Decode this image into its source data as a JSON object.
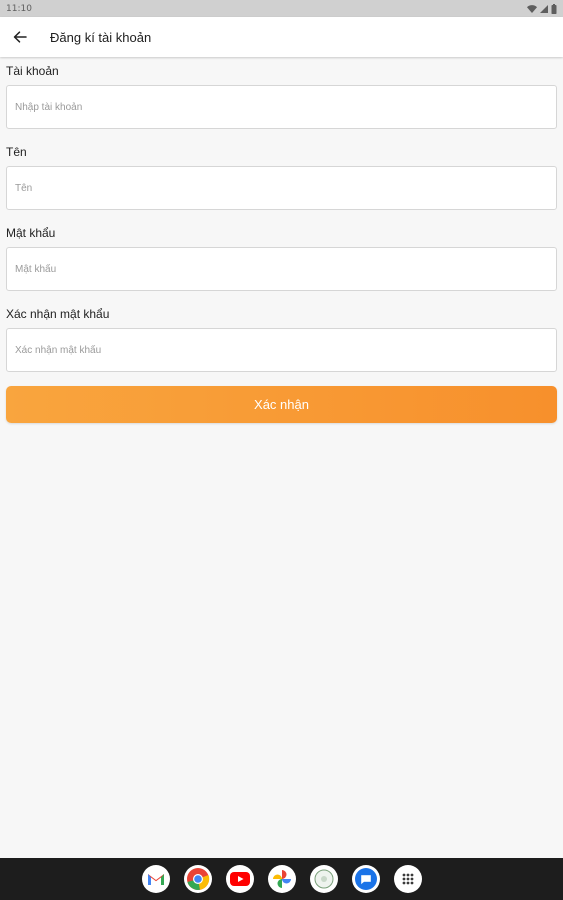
{
  "status_bar": {
    "time": "11:10",
    "icons": [
      "wifi-icon",
      "signal-icon",
      "battery-icon"
    ]
  },
  "app_bar": {
    "back_icon": "arrow-left-icon",
    "title": "Đăng kí tài khoản"
  },
  "form": {
    "fields": [
      {
        "label": "Tài khoản",
        "placeholder": "Nhập tài khoản",
        "value": ""
      },
      {
        "label": "Tên",
        "placeholder": "Tên",
        "value": ""
      },
      {
        "label": "Mật khẩu",
        "placeholder": "Mật khẩu",
        "value": ""
      },
      {
        "label": "Xác nhận mật khẩu",
        "placeholder": "Xác nhận mật khẩu",
        "value": ""
      }
    ],
    "submit_label": "Xác nhận"
  },
  "colors": {
    "accent_start": "#f9a53e",
    "accent_end": "#f7902c",
    "background": "#f7f7f7",
    "nav_bar": "#1d1d1d"
  },
  "dock": {
    "apps": [
      "gmail-icon",
      "chrome-icon",
      "youtube-icon",
      "photos-icon",
      "camera-icon",
      "messages-icon",
      "app-drawer-icon"
    ]
  }
}
